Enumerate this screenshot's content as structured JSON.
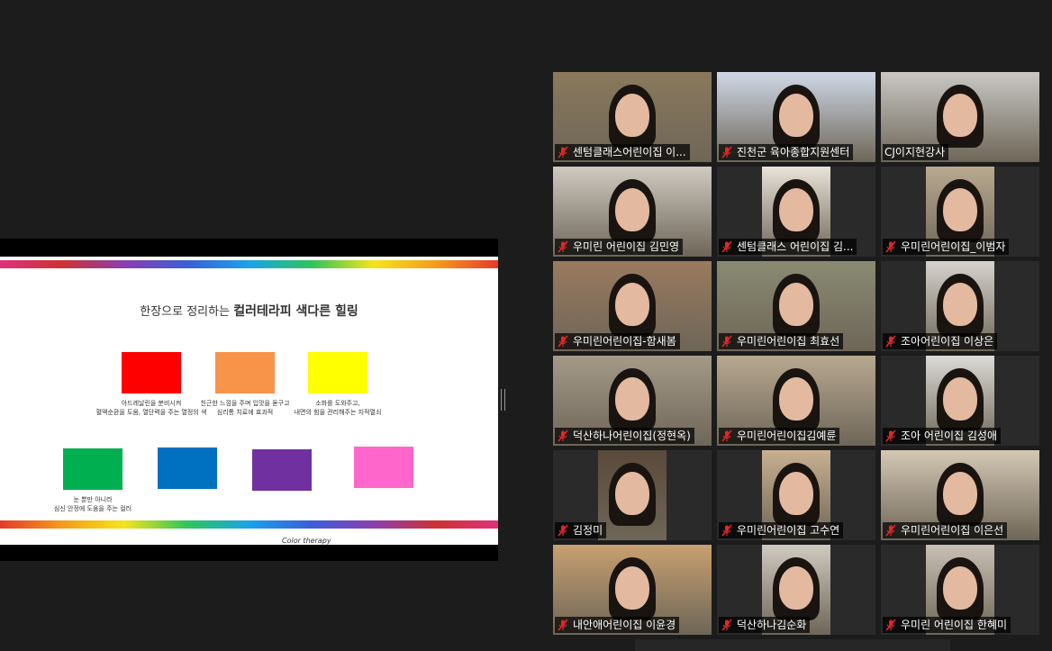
{
  "slide": {
    "title_regular": "한장으로 정리하는",
    "title_bold": "컬러테라피 색다른 힐링",
    "brand_label": "Color therapy",
    "swatches": [
      {
        "color": "#ff0000",
        "caption": "아드레날린을 분비시켜\n혈액순환을 도움, 열단력을 주는 열정의 색"
      },
      {
        "color": "#f7944a",
        "caption": "친근한 느낌을 주며 입맛을 돋구고\n심리통 치료에 효과적"
      },
      {
        "color": "#ffff00",
        "caption": "소화를 도와주고,\n내면의 힘을 관리해주는 지적열쇠"
      },
      {
        "color": "#00b050",
        "caption": "눈 뿐만 아니라\n심신 안정에 도움을 주는 컬러"
      },
      {
        "color": "#0070c0",
        "caption": ""
      },
      {
        "color": "#7030a0",
        "caption": ""
      },
      {
        "color": "#ff66cc",
        "caption": ""
      }
    ]
  },
  "participants": [
    {
      "name": "센텀클래스어린이집 이...",
      "muted": true,
      "bg": "#8a7a5c"
    },
    {
      "name": "진천군 육아종합지원센터",
      "muted": true,
      "bg": "#cfd8e6"
    },
    {
      "name": "CJ이지현강사",
      "muted": false,
      "bg": "#c9c7c4",
      "active": true
    },
    {
      "name": "우미린 어린이집 김민영",
      "muted": true,
      "bg": "#cfc9c0"
    },
    {
      "name": "센텀클래스 어린이집 김...",
      "muted": true,
      "bg": "#e8e2d8"
    },
    {
      "name": "우미린어린이집_이범자",
      "muted": true,
      "bg": "#b9aa90"
    },
    {
      "name": "우미린어린이집-함새봄",
      "muted": true,
      "bg": "#9a7a5e"
    },
    {
      "name": "우미린어린이집 최효선",
      "muted": true,
      "bg": "#8a8a72"
    },
    {
      "name": "조아어린이집 이상은",
      "muted": true,
      "bg": "#d6d2cc"
    },
    {
      "name": "덕산하나어린이집(정현옥)",
      "muted": true,
      "bg": "#a49a88"
    },
    {
      "name": "우미린어린이집김예륜",
      "muted": true,
      "bg": "#b8a890"
    },
    {
      "name": "조아 어린이집 김성애",
      "muted": true,
      "bg": "#dcdad6"
    },
    {
      "name": "김정미",
      "muted": true,
      "bg": "#5a4a3a"
    },
    {
      "name": "우미린어린이집 고수연",
      "muted": true,
      "bg": "#c8b090"
    },
    {
      "name": "우미린어린이집 이은선",
      "muted": true,
      "bg": "#d4c8b4"
    },
    {
      "name": "내안애어린이집 이윤경",
      "muted": true,
      "bg": "#c8a070"
    },
    {
      "name": "덕산하나김순화",
      "muted": true,
      "bg": "#cfcac0"
    },
    {
      "name": "우미린 어린이집 한혜미",
      "muted": true,
      "bg": "#c8c0b4"
    }
  ]
}
